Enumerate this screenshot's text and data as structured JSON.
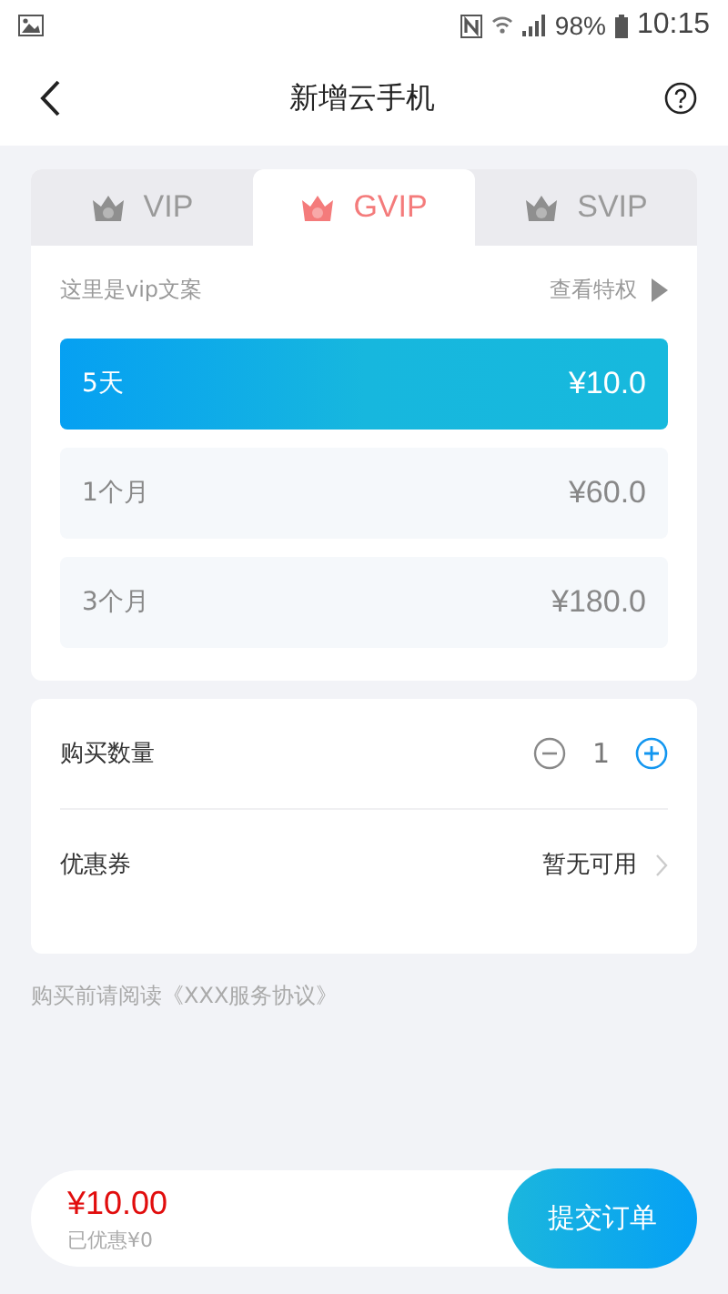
{
  "status_bar": {
    "battery": "98%",
    "time": "10:15"
  },
  "nav": {
    "title": "新增云手机"
  },
  "tabs": [
    {
      "label": "VIP",
      "selected": false
    },
    {
      "label": "GVIP",
      "selected": true
    },
    {
      "label": "SVIP",
      "selected": false
    }
  ],
  "plan_card": {
    "intro": "这里是vip文案",
    "link": "查看特权",
    "plans": [
      {
        "name": "5天",
        "price": "¥10.0",
        "selected": true
      },
      {
        "name": "1个月",
        "price": "¥60.0",
        "selected": false
      },
      {
        "name": "3个月",
        "price": "¥180.0",
        "selected": false
      }
    ]
  },
  "order_card": {
    "quantity_label": "购买数量",
    "quantity": "1",
    "coupon_label": "优惠券",
    "coupon_value": "暂无可用"
  },
  "agreement": "购买前请阅读《XXX服务协议》",
  "footer": {
    "total": "¥10.00",
    "discount": "已优惠¥0",
    "submit": "提交订单"
  }
}
